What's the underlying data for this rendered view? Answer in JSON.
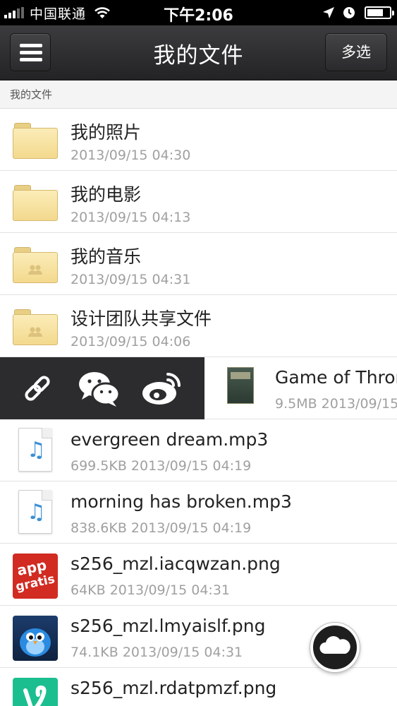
{
  "status_bar": {
    "carrier": "中国联通",
    "time": "下午2:06"
  },
  "nav": {
    "title": "我的文件",
    "multi_select_label": "多选"
  },
  "section": {
    "label": "我的文件"
  },
  "folders": [
    {
      "name": "我的照片",
      "date": "2013/09/15 04:30",
      "shared": false
    },
    {
      "name": "我的电影",
      "date": "2013/09/15 04:13",
      "shared": false
    },
    {
      "name": "我的音乐",
      "date": "2013/09/15 04:31",
      "shared": true
    },
    {
      "name": "设计团队共享文件",
      "date": "2013/09/15 04:06",
      "shared": true
    }
  ],
  "swipe_row": {
    "title": "Game of Throne",
    "meta": "9.5MB 2013/09/15",
    "actions": [
      "link-icon",
      "wechat-icon",
      "weibo-icon"
    ]
  },
  "files": [
    {
      "name": "evergreen dream.mp3",
      "meta": "699.5KB 2013/09/15 04:19",
      "icon": "audio-file-icon"
    },
    {
      "name": "morning has broken.mp3",
      "meta": "838.6KB 2013/09/15 04:19",
      "icon": "audio-file-icon"
    },
    {
      "name": "s256_mzl.iacqwzan.png",
      "meta": "64KB 2013/09/15 04:31",
      "icon": "appgratis-thumbnail",
      "thumb_text": [
        "app",
        "gratis"
      ]
    },
    {
      "name": "s256_mzl.lmyaislf.png",
      "meta": "74.1KB 2013/09/15 04:31",
      "icon": "bird-thumbnail"
    },
    {
      "name": "s256_mzl.rdatpmzf.png",
      "meta": "",
      "icon": "vine-thumbnail"
    }
  ],
  "colors": {
    "nav_bg": "#2f2f31",
    "folder_fill": "#f6dd94",
    "audio_note": "#3a8fd6",
    "action_bar": "#2c2c2e"
  }
}
